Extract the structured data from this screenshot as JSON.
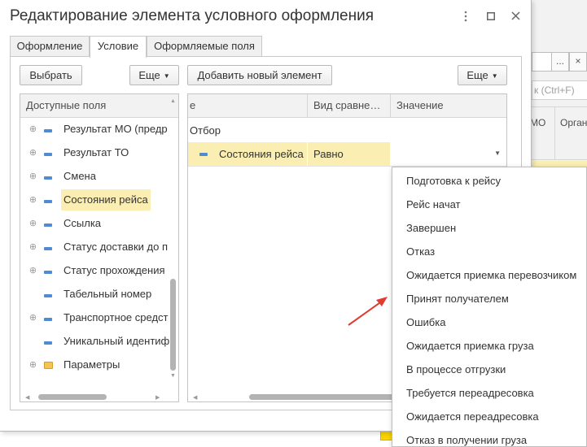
{
  "background": {
    "field_btn_1": "...",
    "field_btn_2": "×",
    "search_placeholder": "к (Ctrl+F)",
    "col1": "МО",
    "col2": "Орган"
  },
  "dialog": {
    "title": "Редактирование элемента условного оформления",
    "menu_icon": "more-vertical-icon",
    "maximize_icon": "maximize-icon",
    "close_icon": "close-icon"
  },
  "tabs": [
    {
      "label": "Оформление",
      "active": false
    },
    {
      "label": "Условие",
      "active": true
    },
    {
      "label": "Оформляемые поля",
      "active": false
    }
  ],
  "left_toolbar": {
    "select_label": "Выбрать",
    "more_label": "Еще"
  },
  "right_toolbar": {
    "add_label": "Добавить новый элемент",
    "more_label": "Еще"
  },
  "available_fields": {
    "header": "Доступные поля",
    "items": [
      {
        "label": "Результат МО (предр",
        "expandable": true,
        "type": "field",
        "selected": false
      },
      {
        "label": "Результат ТО",
        "expandable": true,
        "type": "field",
        "selected": false
      },
      {
        "label": "Смена",
        "expandable": true,
        "type": "field",
        "selected": false
      },
      {
        "label": "Состояния рейса",
        "expandable": true,
        "type": "field",
        "selected": true
      },
      {
        "label": "Ссылка",
        "expandable": true,
        "type": "field",
        "selected": false
      },
      {
        "label": "Статус доставки до п",
        "expandable": true,
        "type": "field",
        "selected": false
      },
      {
        "label": "Статус прохождения",
        "expandable": true,
        "type": "field",
        "selected": false
      },
      {
        "label": "Табельный номер",
        "expandable": false,
        "type": "field",
        "selected": false
      },
      {
        "label": "Транспортное средст",
        "expandable": true,
        "type": "field",
        "selected": false
      },
      {
        "label": "Уникальный идентиф",
        "expandable": false,
        "type": "field",
        "selected": false
      },
      {
        "label": "Параметры",
        "expandable": true,
        "type": "folder",
        "selected": false
      }
    ]
  },
  "conditions_grid": {
    "columns": {
      "field": "е",
      "comparison": "Вид сравне…",
      "value": "Значение"
    },
    "group_label": "Отбор",
    "row": {
      "field": "Состояния рейса",
      "comparison": "Равно",
      "value": ""
    }
  },
  "dropdown_options": [
    "Подготовка к рейсу",
    "Рейс начат",
    "Завершен",
    "Отказ",
    "Ожидается приемка перевозчиком",
    "Принят получателем",
    "Ошибка",
    "Ожидается приемка груза",
    "В процессе отгрузки",
    "Требуется переадресовка",
    "Ожидается переадресовка",
    "Отказ в получении груза"
  ],
  "colors": {
    "selection": "#fbeeb3",
    "field_icon": "#4f8bd0",
    "folder_icon": "#f3c451",
    "annotation_arrow": "#e03c31",
    "accent_button": "#fbd400"
  }
}
